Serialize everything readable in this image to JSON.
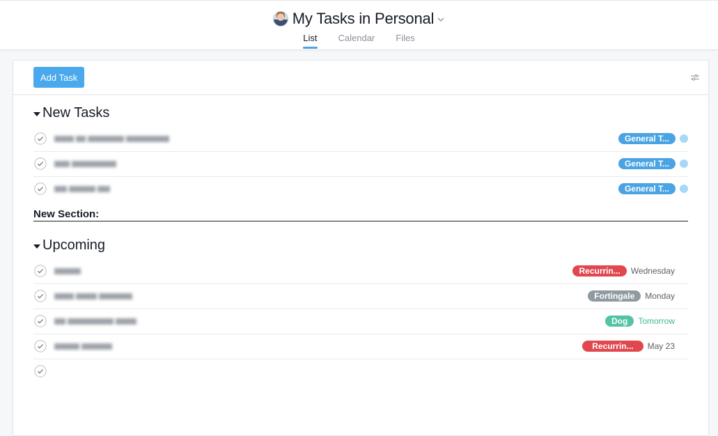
{
  "header": {
    "title": "My Tasks in Personal",
    "avatar_icon": "user-avatar",
    "dropdown_icon": "chevron-down-icon",
    "tabs": [
      {
        "label": "List",
        "active": true
      },
      {
        "label": "Calendar",
        "active": false
      },
      {
        "label": "Files",
        "active": false
      }
    ]
  },
  "toolbar": {
    "add_task_label": "Add Task",
    "filter_icon": "sliders-icon"
  },
  "colors": {
    "accent": "#4aa8ec",
    "tab_underline": "#4ba3e6",
    "general_tag": "#4aa3e3",
    "general_dot": "#a7d8f6",
    "recurring_tag": "#e0474f",
    "fortingale_tag": "#8f9ba0",
    "dog_tag": "#52c3a4",
    "tomorrow_text": "#3fb695"
  },
  "sections": {
    "new_tasks": {
      "title": "New Tasks",
      "tasks": [
        {
          "name": "[redacted]",
          "tag": "General T...",
          "tag_color": "#4aa3e3",
          "dot_color": "#a7d8f6"
        },
        {
          "name": "[redacted]",
          "tag": "General T...",
          "tag_color": "#4aa3e3",
          "dot_color": "#a7d8f6"
        },
        {
          "name": "[redacted]",
          "tag": "General T...",
          "tag_color": "#4aa3e3",
          "dot_color": "#a7d8f6"
        }
      ]
    },
    "new_section": {
      "title": "New Section:"
    },
    "upcoming": {
      "title": "Upcoming",
      "tasks": [
        {
          "name": "[redacted]",
          "tag": "Recurrin...",
          "tag_color": "#e0474f",
          "due": "Wednesday",
          "due_color": "#5b6068"
        },
        {
          "name": "[redacted]",
          "tag": "Fortingale",
          "tag_color": "#8f9ba0",
          "due": "Monday",
          "due_color": "#5b6068"
        },
        {
          "name": "[redacted]",
          "tag": "Dog",
          "tag_color": "#52c3a4",
          "due": "Tomorrow",
          "due_color": "#3fb695"
        },
        {
          "name": "[redacted]",
          "tag": "Recurrin...",
          "tag_color": "#e0474f",
          "due": "May 23",
          "due_color": "#5b6068"
        },
        {
          "name": "",
          "tag": "",
          "due": ""
        }
      ]
    }
  }
}
